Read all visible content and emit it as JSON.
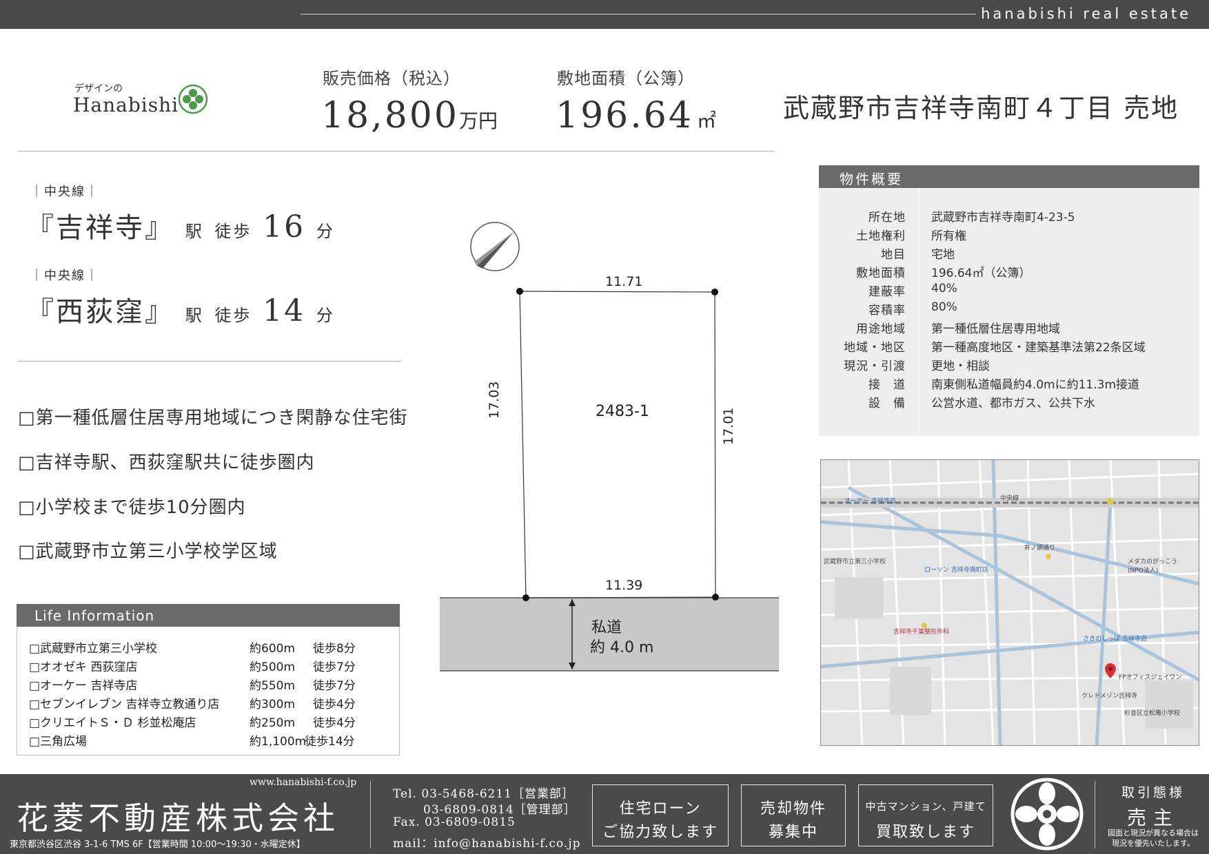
{
  "header": {
    "brand": "hanabishi real estate"
  },
  "logo": {
    "small": "デザインの",
    "name": "Hanabishi"
  },
  "price": {
    "label": "販売価格（税込）",
    "value": "18,800",
    "unit": "万円"
  },
  "area": {
    "label": "敷地面積（公簿）",
    "value": "196.64",
    "unit": "㎡"
  },
  "title": "武蔵野市吉祥寺南町４丁目 売地",
  "stations": [
    {
      "line": "｜中央線｜",
      "name": "『吉祥寺』",
      "eki": "駅",
      "toho": "徒歩",
      "min": "16",
      "fun": "分"
    },
    {
      "line": "｜中央線｜",
      "name": "『西荻窪』",
      "eki": "駅",
      "toho": "徒歩",
      "min": "14",
      "fun": "分"
    }
  ],
  "features": [
    "□第一種低層住居専用地域につき閑静な住宅街",
    "□吉祥寺駅、西荻窪駅共に徒歩圏内",
    "□小学校まで徒歩10分圏内",
    "□武蔵野市立第三小学校学区域"
  ],
  "life": {
    "title": "Life Information",
    "rows": [
      {
        "name": "□武蔵野市立第三小学校",
        "dist": "約600m",
        "walk": "徒歩8分"
      },
      {
        "name": "□オオゼキ 西荻窪店",
        "dist": "約500m",
        "walk": "徒歩7分"
      },
      {
        "name": "□オーケー 吉祥寺店",
        "dist": "約550m",
        "walk": "徒歩7分"
      },
      {
        "name": "□セブンイレブン 吉祥寺立教通り店",
        "dist": "約300m",
        "walk": "徒歩4分"
      },
      {
        "name": "□クリエイトＳ・Ｄ 杉並松庵店",
        "dist": "約250m",
        "walk": "徒歩4分"
      },
      {
        "name": "□三角広場",
        "dist": "約1,100m",
        "walk": "徒歩14分"
      }
    ]
  },
  "plot": {
    "top": "11.71",
    "bottom": "11.39",
    "left": "17.03",
    "right": "17.01",
    "lot": "2483-1",
    "road_1": "私道",
    "road_2": "約 4.0 m"
  },
  "overview": {
    "title": "物件概要",
    "rows": [
      {
        "k": "所在地",
        "v": "武蔵野市吉祥寺南町4-23-5"
      },
      {
        "k": "土地権利",
        "v": "所有権"
      },
      {
        "k": "地目",
        "v": "宅地"
      },
      {
        "k": "敷地面積",
        "v": "196.64㎡（公簿）"
      },
      {
        "k": "建蔽率",
        "v": "40%"
      },
      {
        "k": "容積率",
        "v": "80%"
      },
      {
        "k": "用途地域",
        "v": "第一種低層住居専用地域"
      },
      {
        "k": "地域・地区",
        "v": "第一種高度地区・建築基準法第22条区域"
      },
      {
        "k": "現況・引渡",
        "v": "更地・相談"
      },
      {
        "k": "接　道",
        "v": "南東側私道幅員約4.0mに約11.3m接道"
      },
      {
        "k": "設　備",
        "v": "公営水道、都市ガス、公共下水"
      }
    ]
  },
  "map": {
    "labels": [
      {
        "t": "オーケー 吉祥寺店"
      },
      {
        "t": "武蔵野市立第三小学校"
      },
      {
        "t": "ローソン 吉祥寺南町店"
      },
      {
        "t": "吉祥寺千葉整形外科"
      },
      {
        "t": "さきのしっぽ 吉祥寺店"
      },
      {
        "t": "FPオフィスジェイワン"
      },
      {
        "t": "クレドメゾン吉祥寺"
      },
      {
        "t": "メダカのがっこう(NPO法人)"
      },
      {
        "t": "杉並区立松庵小学校"
      },
      {
        "t": "中央線"
      },
      {
        "t": "井ノ頭通り"
      }
    ]
  },
  "footer": {
    "url": "www.hanabishi-f.co.jp",
    "company": "花菱不動産株式会社",
    "address": "東京都渋谷区渋谷 3-1-6 TMS 6F【営業時間 10:00～19:30・水曜定休】",
    "tel1": "Tel. 03-5468-6211［営業部］",
    "tel2": "03-6809-0814［管理部］",
    "fax": "Fax. 03-6809-0815",
    "mail": "mail：info@hanabishi-f.co.jp",
    "box1": {
      "l1": "住宅ローン",
      "l2": "ご協力致します"
    },
    "box2": {
      "l1": "売却物件",
      "l2": "募集中"
    },
    "box3": {
      "l1": "中古マンション、戸建て",
      "l2": "買取致します"
    },
    "deal_title": "取引態様",
    "deal_value": "売主",
    "deal_note_1": "図面と現況が異なる場合は",
    "deal_note_2": "現況を優先いたします。"
  },
  "colors": {
    "bar": "#4a4a4a",
    "accent": "#4a9a4a",
    "road": "#c8c8c8"
  }
}
